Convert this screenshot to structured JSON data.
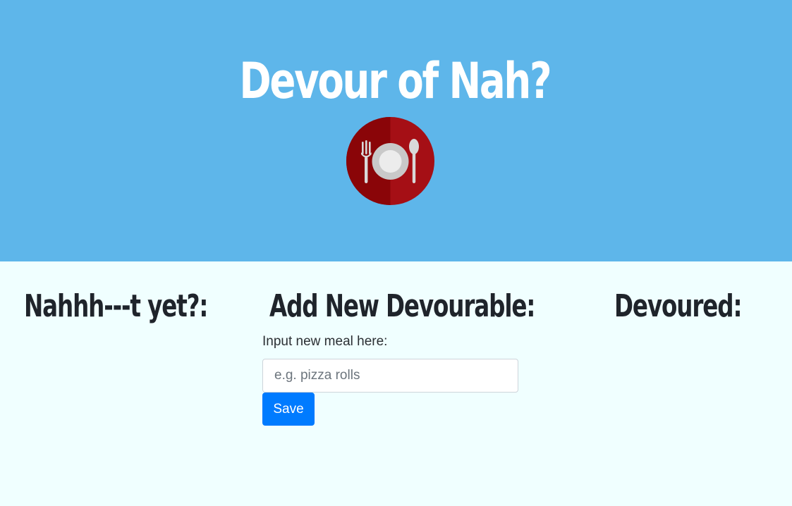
{
  "header": {
    "title": "Devour of Nah?",
    "logo_icon": "plate-fork-spoon-icon"
  },
  "columns": {
    "not_yet_heading": "Nahhh---t yet?:",
    "add_heading": "Add New Devourable:",
    "devoured_heading": "Devoured:"
  },
  "form": {
    "label": "Input new meal here:",
    "input_value": "",
    "input_placeholder": "e.g. pizza rolls",
    "save_label": "Save"
  },
  "colors": {
    "hero_background": "#5eb6ea",
    "page_background": "#f0ffff",
    "heading_text": "#1f242b",
    "primary_button": "#007bff",
    "logo_red": "#a50f15",
    "logo_dark_red": "#8a0508"
  }
}
